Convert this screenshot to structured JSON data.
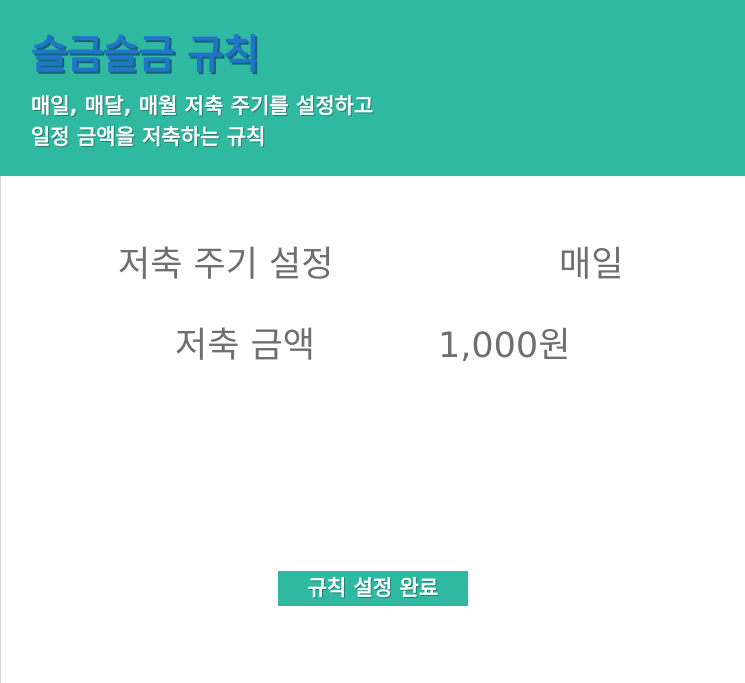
{
  "header": {
    "title": "슬금슬금 규칙",
    "subtitle_line1": "매일, 매달, 매월 저축 주기를 설정하고",
    "subtitle_line2": "일정 금액을 저축하는 규칙"
  },
  "settings": {
    "period_label": "저축 주기 설정",
    "period_value": "매일",
    "amount_label": "저축 금액",
    "amount_value": "1,000원"
  },
  "actions": {
    "complete_label": "규칙 설정 완료"
  },
  "colors": {
    "header_bg": "#2fb9a0",
    "title_text": "#1f76c8",
    "body_text": "#6f6f6f",
    "button_bg": "#2fb9a0"
  }
}
